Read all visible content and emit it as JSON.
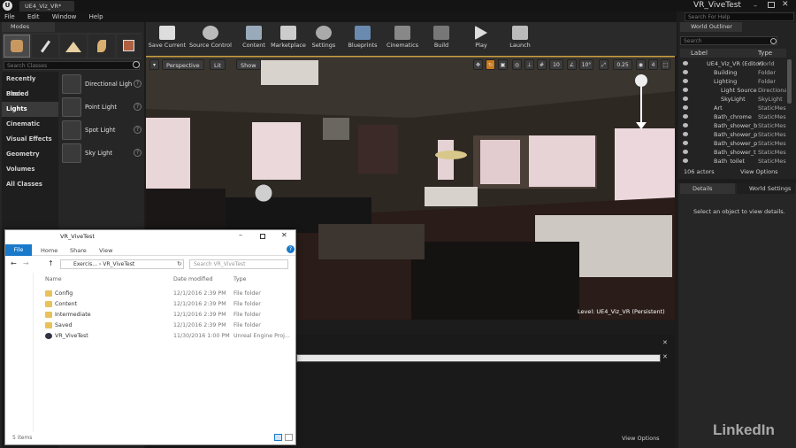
{
  "titlebar": {
    "tab": "UE4_Viz_VR*",
    "project": "VR_ViveTest",
    "help_placeholder": "Search For Help"
  },
  "menu": [
    "File",
    "Edit",
    "Window",
    "Help"
  ],
  "modes": {
    "title": "Modes",
    "search_placeholder": "Search Classes",
    "categories": [
      "Recently Placed",
      "Basic",
      "Lights",
      "Cinematic",
      "Visual Effects",
      "Geometry",
      "Volumes",
      "All Classes"
    ],
    "lights": [
      "Directional Ligh",
      "Point Light",
      "Spot Light",
      "Sky Light"
    ]
  },
  "toolbar": [
    "Save Current",
    "Source Control",
    "Content",
    "Marketplace",
    "Settings",
    "Blueprints",
    "Cinematics",
    "Build",
    "Play",
    "Launch"
  ],
  "viewport": {
    "perspective": "Perspective",
    "lit": "Lit",
    "show": "Show",
    "grid": "10",
    "rot": "10°",
    "scale": "0.25",
    "cam": "4",
    "level": "Level:  UE4_Viz_VR (Persistent)"
  },
  "outliner": {
    "title": "World Outliner",
    "search_placeholder": "Search",
    "col_label": "Label",
    "col_type": "Type",
    "rows": [
      {
        "label": "UE4_Viz_VR (Editor)",
        "type": "World"
      },
      {
        "label": "Building",
        "type": "Folder"
      },
      {
        "label": "Lighting",
        "type": "Folder"
      },
      {
        "label": "Light Source",
        "type": "Directiona"
      },
      {
        "label": "SkyLight",
        "type": "SkyLight"
      },
      {
        "label": "Art",
        "type": "StaticMesh"
      },
      {
        "label": "Bath_chrome",
        "type": "StaticMesh"
      },
      {
        "label": "Bath_shower_b",
        "type": "StaticMesh"
      },
      {
        "label": "Bath_shower_p",
        "type": "StaticMesh"
      },
      {
        "label": "Bath_shower_p",
        "type": "StaticMesh"
      },
      {
        "label": "Bath_shower_t",
        "type": "StaticMesh"
      },
      {
        "label": "Bath_toilet",
        "type": "StaticMesh"
      }
    ],
    "count": "106 actors",
    "view_options": "View Options"
  },
  "details": {
    "tab": "Details",
    "world_tab": "World Settings",
    "empty": "Select an object to view details."
  },
  "bottom": {
    "view_options": "View Options"
  },
  "explorer": {
    "title": "VR_ViveTest",
    "tabs": [
      "File",
      "Home",
      "Share",
      "View"
    ],
    "path": [
      "Exercis...",
      "VR_ViveTest"
    ],
    "search_placeholder": "Search VR_ViveTest",
    "cols": [
      "Name",
      "Date modified",
      "Type"
    ],
    "rows": [
      {
        "name": "Config",
        "date": "12/1/2016 2:39 PM",
        "type": "File folder"
      },
      {
        "name": "Content",
        "date": "12/1/2016 2:39 PM",
        "type": "File folder"
      },
      {
        "name": "Intermediate",
        "date": "12/1/2016 2:39 PM",
        "type": "File folder"
      },
      {
        "name": "Saved",
        "date": "12/1/2016 2:39 PM",
        "type": "File folder"
      },
      {
        "name": "VR_ViveTest",
        "date": "11/30/2016 1:00 PM",
        "type": "Unreal Engine Proj..."
      }
    ],
    "status": "5 items"
  },
  "watermark": "LinkedIn"
}
